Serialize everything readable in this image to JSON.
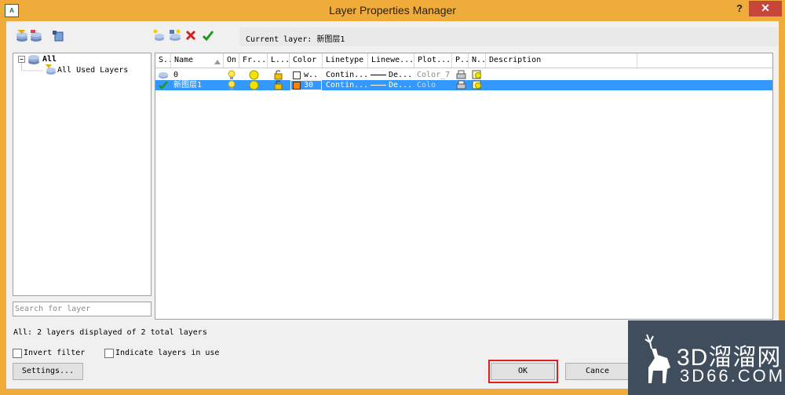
{
  "window": {
    "title": "Layer Properties Manager",
    "help_label": "?",
    "close_label": "✕",
    "app_icon_label": "A"
  },
  "toolbar": {
    "current_layer_label": "Current layer:",
    "current_layer_value": "新图层1",
    "icons": [
      "new-property-filter-icon",
      "new-group-filter-icon",
      "layer-states-icon",
      "new-layer-icon",
      "new-layer-vp-frozen-icon",
      "delete-layer-icon",
      "set-current-icon"
    ]
  },
  "tree": {
    "root_label": "All",
    "child_label": "All Used Layers"
  },
  "search": {
    "placeholder": "Search for layer"
  },
  "grid": {
    "columns": [
      "S..",
      "Name",
      "On",
      "Fr...",
      "L...",
      "Color",
      "Linetype",
      "Linewe...",
      "Plot...",
      "P..",
      "N..",
      "Description"
    ],
    "rows": [
      {
        "name": "0",
        "color_name": "w...",
        "color_swatch": "#ffffff",
        "linetype": "Contin...",
        "lineweight": "De...",
        "plot_style": "Color_7",
        "selected": false
      },
      {
        "name": "新图层1",
        "color_name": "30",
        "color_swatch": "#ff7f00",
        "linetype": "Contin...",
        "lineweight": "De...",
        "plot_style": "Colo",
        "selected": true
      }
    ]
  },
  "status": {
    "text": "All: 2 layers displayed of 2 total layers"
  },
  "options": {
    "invert_filter": "Invert filter",
    "indicate_layers": "Indicate layers in use"
  },
  "buttons": {
    "settings": "Settings...",
    "ok": "OK",
    "cancel": "Cance"
  },
  "watermark": {
    "line1": "3D溜溜网",
    "line2": "3D66.COM"
  }
}
